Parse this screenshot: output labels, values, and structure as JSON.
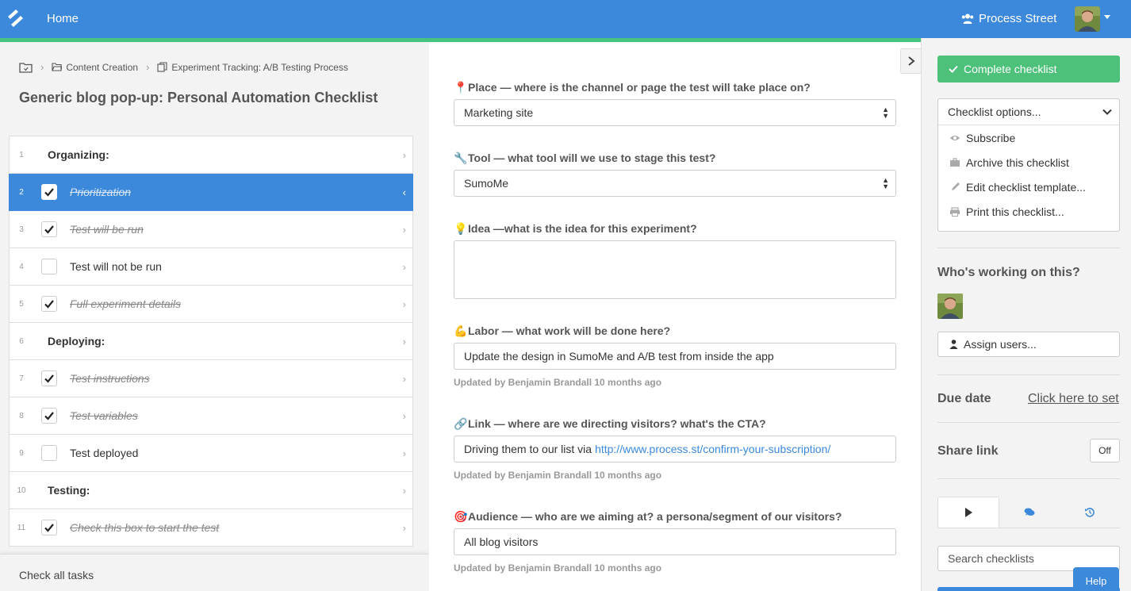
{
  "topbar": {
    "home_label": "Home",
    "org_label": "Process Street",
    "logo_icon": "process-street-logo-icon",
    "brand_color": "#3c89dc",
    "accent_color": "#45c37f"
  },
  "breadcrumb": {
    "items": [
      {
        "icon": "folder-icon",
        "label": ""
      },
      {
        "icon": "folder-open-icon",
        "label": "Content Creation"
      },
      {
        "icon": "template-icon",
        "label": "Experiment Tracking: A/B Testing Process"
      }
    ]
  },
  "page_title": "Generic blog pop-up: Personal Automation Checklist",
  "tasks": [
    {
      "num": "1",
      "label": "Organizing:",
      "type": "heading"
    },
    {
      "num": "2",
      "label": "Prioritization",
      "type": "task",
      "checked": true,
      "active": true
    },
    {
      "num": "3",
      "label": "Test will be run",
      "type": "task",
      "checked": true
    },
    {
      "num": "4",
      "label": "Test will not be run",
      "type": "task",
      "checked": false
    },
    {
      "num": "5",
      "label": "Full experiment details",
      "type": "task",
      "checked": true
    },
    {
      "num": "6",
      "label": "Deploying:",
      "type": "heading"
    },
    {
      "num": "7",
      "label": "Test instructions",
      "type": "task",
      "checked": true
    },
    {
      "num": "8",
      "label": "Test variables",
      "type": "task",
      "checked": true
    },
    {
      "num": "9",
      "label": "Test deployed",
      "type": "task",
      "checked": false
    },
    {
      "num": "10",
      "label": "Testing:",
      "type": "heading"
    },
    {
      "num": "11",
      "label": "Check this box to start the test",
      "type": "task",
      "checked": true
    }
  ],
  "check_all_label": "Check all tasks",
  "form": {
    "place": {
      "emoji": "📍",
      "label": "Place — where is the channel or page the test will take place on?",
      "value": "Marketing site"
    },
    "tool": {
      "emoji": "🔧",
      "label": "Tool — what tool will we use to stage this test?",
      "value": "SumoMe"
    },
    "idea": {
      "emoji": "💡",
      "label": "Idea —what is the idea for this experiment?",
      "value": ""
    },
    "labor": {
      "emoji": "💪",
      "label": "Labor — what work will be done here?",
      "value": "Update the design in SumoMe and A/B test from inside the app",
      "updated": "Updated by Benjamin Brandall 10 months ago"
    },
    "link": {
      "emoji": "🔗",
      "label": "Link — where are we directing visitors? what's the CTA?",
      "value_prefix": "Driving them to our list via",
      "value_link": "http://www.process.st/confirm-your-subscription/",
      "updated": "Updated by Benjamin Brandall 10 months ago"
    },
    "audience": {
      "emoji": "🎯",
      "label": "Audience — who are we aiming at? a persona/segment of our visitors?",
      "value": "All blog visitors",
      "updated": "Updated by Benjamin Brandall 10 months ago"
    }
  },
  "sidebar": {
    "complete_label": "Complete checklist",
    "options_label": "Checklist options...",
    "options": [
      {
        "icon": "eye-icon",
        "label": "Subscribe"
      },
      {
        "icon": "briefcase-icon",
        "label": "Archive this checklist"
      },
      {
        "icon": "pencil-icon",
        "label": "Edit checklist template..."
      },
      {
        "icon": "print-icon",
        "label": "Print this checklist..."
      }
    ],
    "working_title": "Who's working on this?",
    "assign_label": "Assign users...",
    "due_title": "Due date",
    "due_link": "Click here to set",
    "share_title": "Share link",
    "share_toggle": "Off",
    "tabs": [
      "play-icon",
      "comments-icon",
      "history-icon"
    ],
    "search_placeholder": "Search checklists",
    "complete_color": "#4dc07a"
  },
  "help_label": "Help"
}
